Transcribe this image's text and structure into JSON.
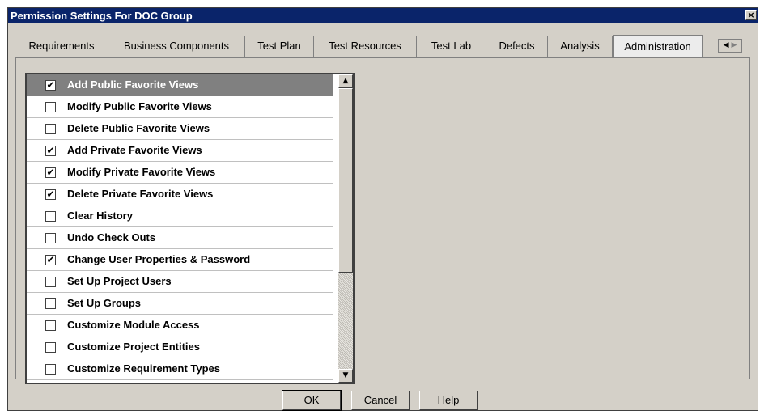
{
  "window": {
    "title": "Permission Settings For DOC Group",
    "close_glyph": "×"
  },
  "tabs": [
    {
      "label": "Requirements"
    },
    {
      "label": "Business Components"
    },
    {
      "label": "Test Plan"
    },
    {
      "label": "Test Resources"
    },
    {
      "label": "Test Lab"
    },
    {
      "label": "Defects"
    },
    {
      "label": "Analysis"
    },
    {
      "label": "Administration",
      "active": true
    }
  ],
  "tab_scroll": {
    "left_glyph": "◀",
    "right_glyph": "▶"
  },
  "permissions": [
    {
      "label": "Add Public Favorite Views",
      "checked": true,
      "selected": true
    },
    {
      "label": "Modify Public Favorite Views",
      "checked": false
    },
    {
      "label": "Delete Public Favorite Views",
      "checked": false
    },
    {
      "label": "Add Private Favorite Views",
      "checked": true
    },
    {
      "label": "Modify Private Favorite Views",
      "checked": true
    },
    {
      "label": "Delete Private Favorite Views",
      "checked": true
    },
    {
      "label": "Clear History",
      "checked": false
    },
    {
      "label": "Undo Check Outs",
      "checked": false
    },
    {
      "label": "Change User Properties & Password",
      "checked": true
    },
    {
      "label": "Set Up Project Users",
      "checked": false
    },
    {
      "label": "Set Up Groups",
      "checked": false
    },
    {
      "label": "Customize Module Access",
      "checked": false
    },
    {
      "label": "Customize Project Entities",
      "checked": false
    },
    {
      "label": "Customize Requirement Types",
      "checked": false
    }
  ],
  "scrollbar": {
    "up_glyph": "▲",
    "down_glyph": "▼"
  },
  "buttons": {
    "ok": "OK",
    "cancel": "Cancel",
    "help": "Help"
  },
  "checkmark": "✔"
}
